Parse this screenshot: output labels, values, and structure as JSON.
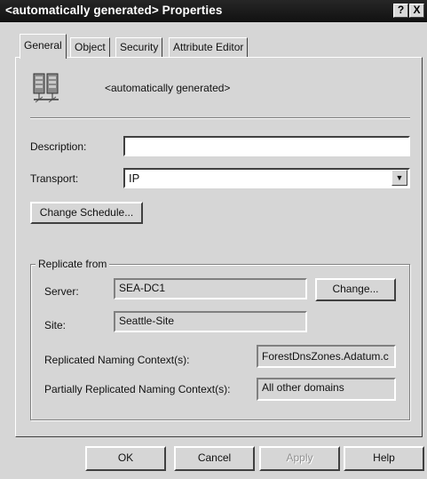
{
  "window": {
    "title": "<automatically generated> Properties",
    "help_glyph": "?",
    "close_glyph": "X"
  },
  "tabs": [
    {
      "label": "General",
      "active": true
    },
    {
      "label": "Object",
      "active": false
    },
    {
      "label": "Security",
      "active": false
    },
    {
      "label": "Attribute Editor",
      "active": false
    }
  ],
  "general": {
    "object_icon": "server-pair-icon",
    "object_name": "<automatically generated>",
    "description_label": "Description:",
    "description_value": "",
    "transport_label": "Transport:",
    "transport_value": "IP",
    "change_schedule_label": "Change Schedule...",
    "replicate_from": {
      "legend": "Replicate from",
      "server_label": "Server:",
      "server_value": "SEA-DC1",
      "change_label": "Change...",
      "site_label": "Site:",
      "site_value": "Seattle-Site",
      "replicated_nc_label": "Replicated Naming Context(s):",
      "replicated_nc_value": "ForestDnsZones.Adatum.c",
      "partial_nc_label": "Partially Replicated Naming Context(s):",
      "partial_nc_value": "All other domains"
    }
  },
  "footer": {
    "ok_label": "OK",
    "cancel_label": "Cancel",
    "apply_label": "Apply",
    "help_label": "Help"
  }
}
